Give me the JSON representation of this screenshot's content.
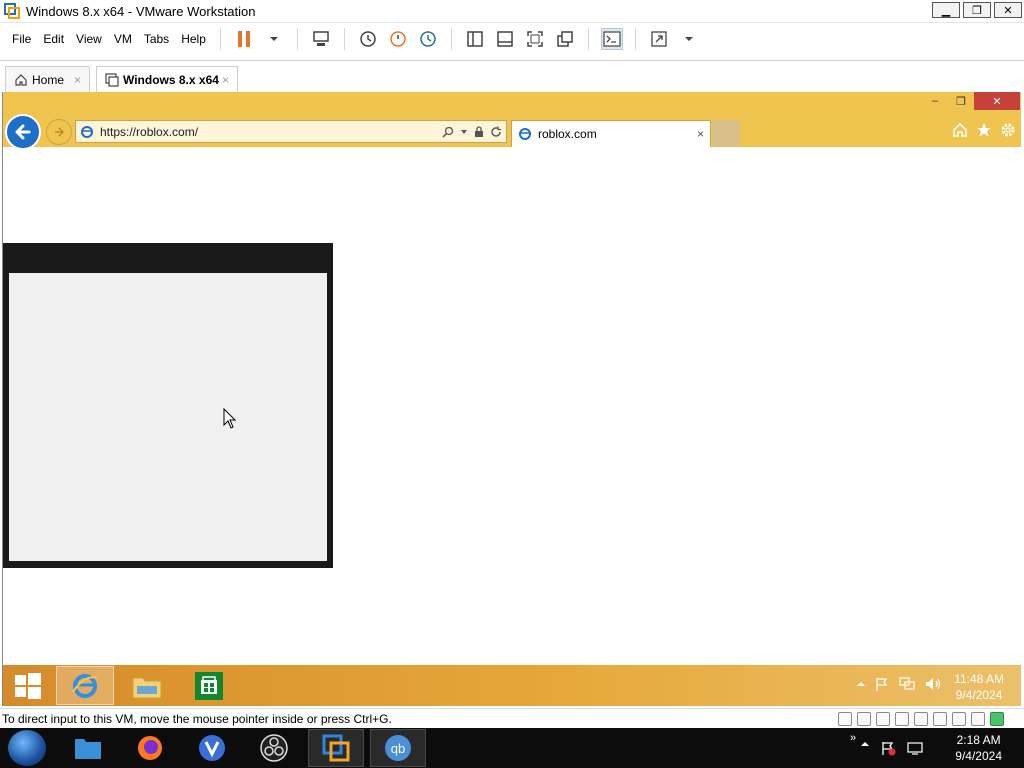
{
  "window": {
    "title": "Windows 8.x x64 - VMware Workstation",
    "controls": {
      "minimize": "▁",
      "restore": "❐",
      "close": "✕"
    }
  },
  "menubar": {
    "items": [
      "File",
      "Edit",
      "View",
      "VM",
      "Tabs",
      "Help"
    ]
  },
  "vm_tabs": {
    "home_label": "Home",
    "vm_label": "Windows 8.x x64",
    "close": "×"
  },
  "ie": {
    "url": "https://roblox.com/",
    "tab_title": "roblox.com",
    "tab_close": "×",
    "minimize": "–",
    "restore": "❐",
    "close": "✕"
  },
  "guest_taskbar": {
    "time": "11:48 AM",
    "date": "9/4/2024"
  },
  "status_bar": {
    "text": "To direct input to this VM, move the mouse pointer inside or press Ctrl+G."
  },
  "host_taskbar": {
    "time": "2:18 AM",
    "date": "9/4/2024",
    "chevron": "»"
  },
  "colors": {
    "ie_chrome": "#f0c54f",
    "guest_taskbar": "#e6a83a",
    "ie_close": "#c7403a",
    "host_taskbar": "#0c0c0c"
  }
}
